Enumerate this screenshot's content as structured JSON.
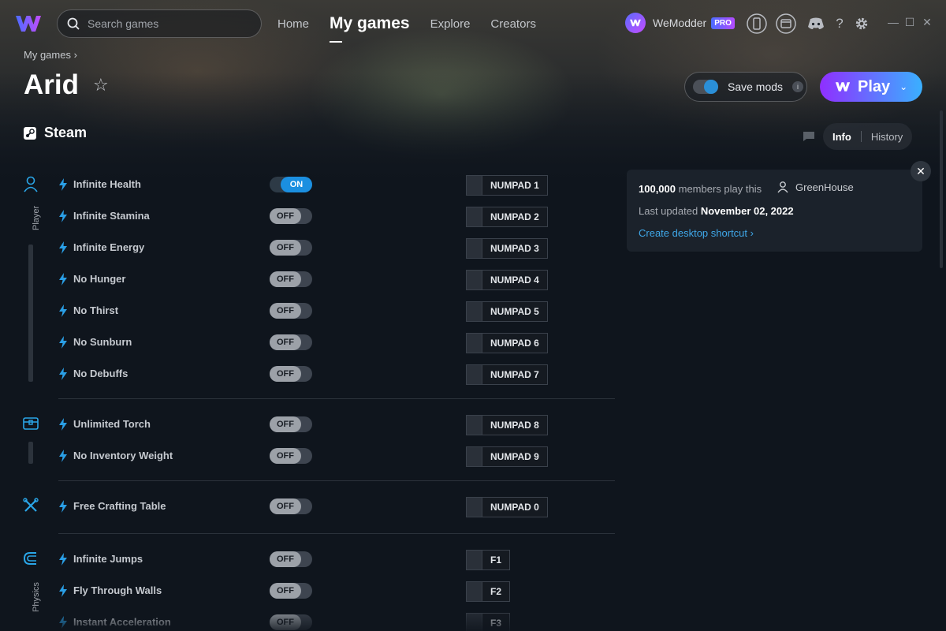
{
  "search": {
    "placeholder": "Search games"
  },
  "nav": {
    "home": "Home",
    "my_games": "My games",
    "explore": "Explore",
    "creators": "Creators"
  },
  "user": {
    "name": "WeModder",
    "badge": "PRO"
  },
  "breadcrumb": "My games",
  "game": {
    "title": "Arid",
    "platform": "Steam"
  },
  "actions": {
    "save_mods": "Save mods",
    "save_info": "i",
    "play": "Play"
  },
  "tabs": {
    "info": "Info",
    "history": "History"
  },
  "info_card": {
    "members_count": "100,000",
    "members_text": "members play this",
    "creator": "GreenHouse",
    "updated_label": "Last updated",
    "updated_date": "November 02, 2022",
    "shortcut": "Create desktop shortcut"
  },
  "categories": [
    {
      "label": "Player",
      "icon": "player-icon"
    },
    {
      "label": "",
      "icon": "inventory-icon"
    },
    {
      "label": "",
      "icon": "crafting-icon"
    },
    {
      "label": "Physics",
      "icon": "physics-icon"
    }
  ],
  "mods": [
    {
      "name": "Infinite Health",
      "state": "ON",
      "hotkey": "NUMPAD 1"
    },
    {
      "name": "Infinite Stamina",
      "state": "OFF",
      "hotkey": "NUMPAD 2"
    },
    {
      "name": "Infinite Energy",
      "state": "OFF",
      "hotkey": "NUMPAD 3"
    },
    {
      "name": "No Hunger",
      "state": "OFF",
      "hotkey": "NUMPAD 4"
    },
    {
      "name": "No Thirst",
      "state": "OFF",
      "hotkey": "NUMPAD 5"
    },
    {
      "name": "No Sunburn",
      "state": "OFF",
      "hotkey": "NUMPAD 6"
    },
    {
      "name": "No Debuffs",
      "state": "OFF",
      "hotkey": "NUMPAD 7"
    },
    {
      "name": "Unlimited Torch",
      "state": "OFF",
      "hotkey": "NUMPAD 8"
    },
    {
      "name": "No Inventory Weight",
      "state": "OFF",
      "hotkey": "NUMPAD 9"
    },
    {
      "name": "Free Crafting Table",
      "state": "OFF",
      "hotkey": "NUMPAD 0"
    },
    {
      "name": "Infinite Jumps",
      "state": "OFF",
      "hotkey": "F1"
    },
    {
      "name": "Fly Through Walls",
      "state": "OFF",
      "hotkey": "F2"
    },
    {
      "name": "Instant Acceleration",
      "state": "OFF",
      "hotkey": "F3"
    }
  ],
  "colors": {
    "accent": "#1b8fe0",
    "play_start": "#8f2fff",
    "play_end": "#3ab0ff",
    "link": "#3fa7e8"
  }
}
